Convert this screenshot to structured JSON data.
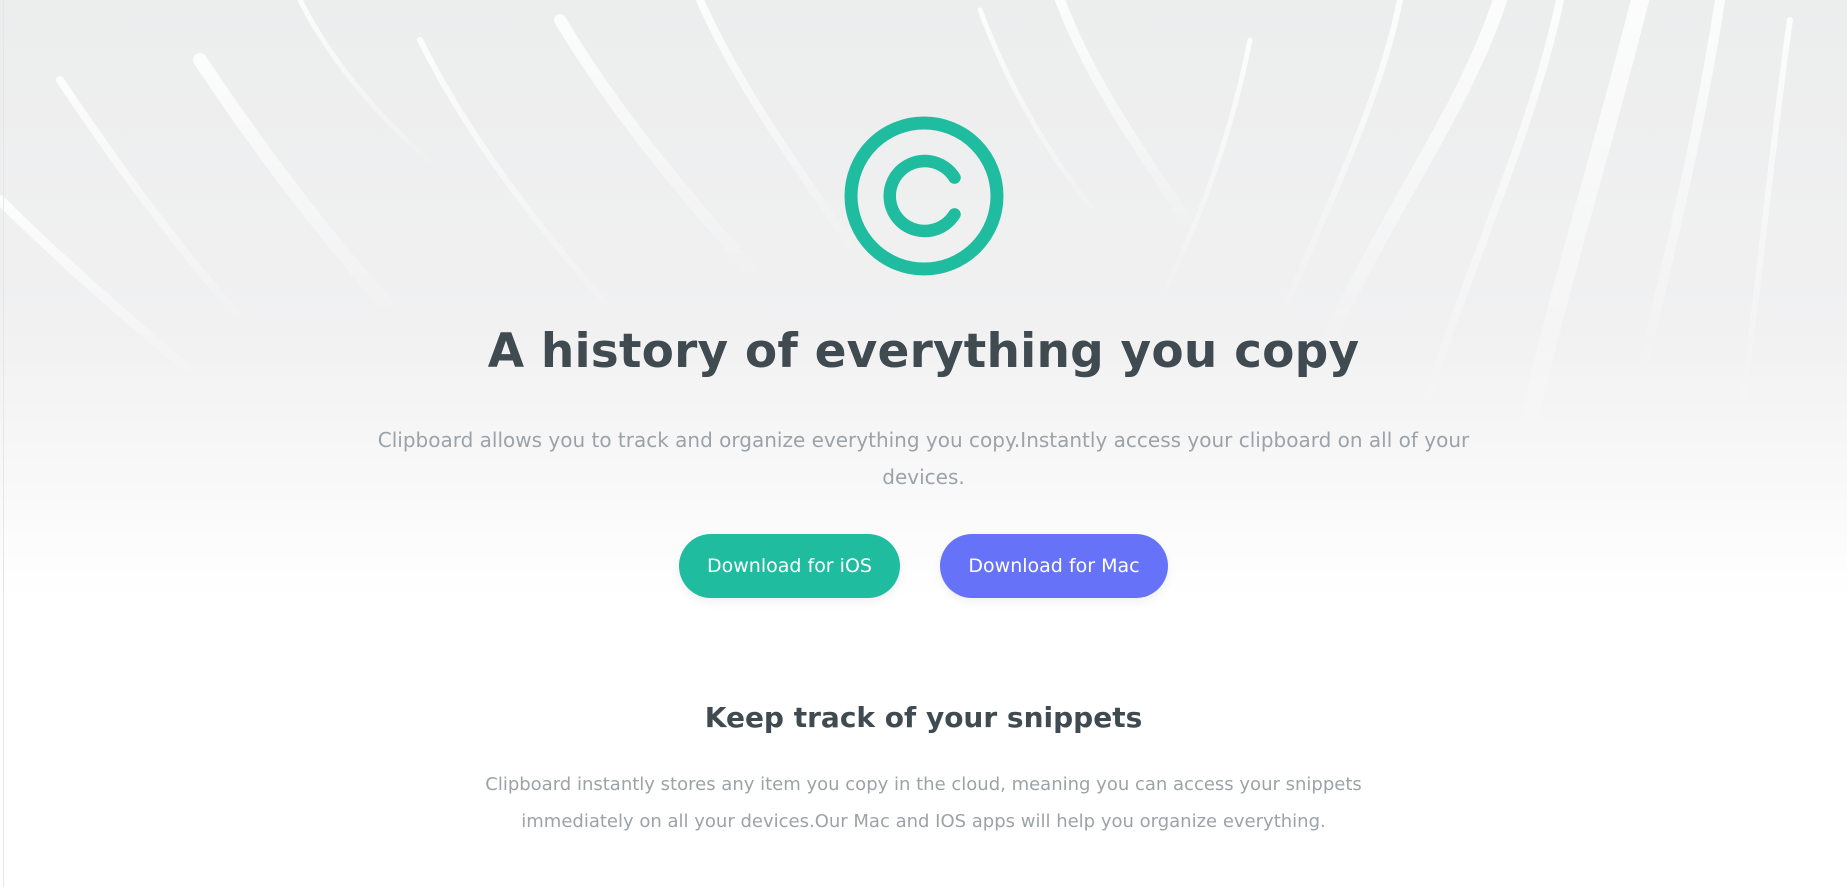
{
  "hero": {
    "logo_icon": "copyright-c-logo-icon",
    "headline": "A history of everything you copy",
    "description": "Clipboard allows you to track and organize everything you copy.Instantly access your clipboard on all of your devices.",
    "buttons": {
      "ios_label": "Download for iOS",
      "mac_label": "Download for Mac"
    }
  },
  "snippets_section": {
    "title": "Keep track of your snippets",
    "body": "Clipboard instantly stores any item you copy in the cloud, meaning you can access your snippets immediately on all your devices.Our Mac and IOS apps will help you organize everything."
  },
  "colors": {
    "accent_teal": "#1fbc9f",
    "accent_blue": "#6672f8",
    "heading_text": "#3f4b51",
    "body_text": "#9ca3a8"
  }
}
